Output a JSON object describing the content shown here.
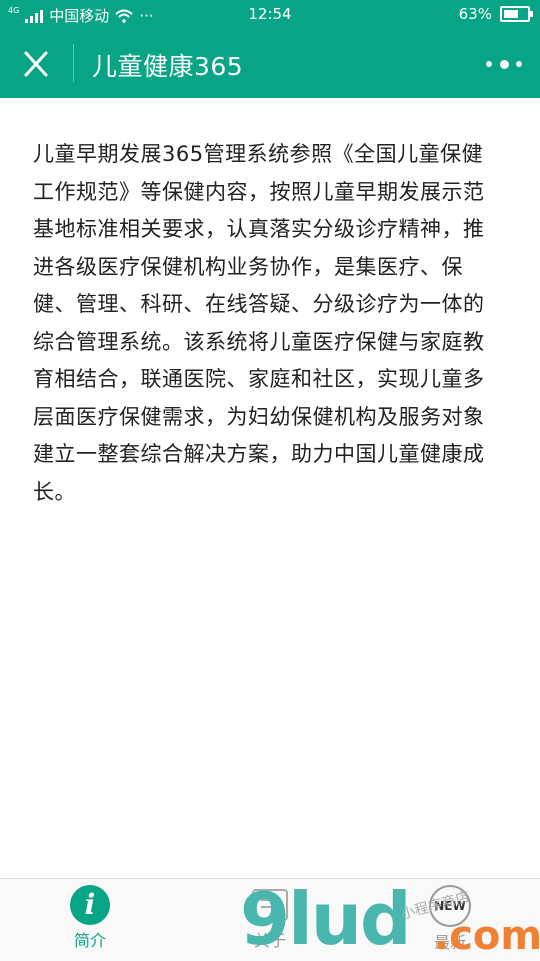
{
  "status_bar": {
    "network_tag": "4G",
    "carrier": "中国移动",
    "wifi_icon": "wifi-icon",
    "more": "···",
    "time": "12:54",
    "battery_percent": "63%",
    "battery_level": 0.63
  },
  "navbar": {
    "title": "儿童健康365",
    "close_icon": "close-icon",
    "more_icon": "more-dots-icon"
  },
  "content": {
    "paragraph": "儿童早期发展365管理系统参照《全国儿童保健工作规范》等保健内容，按照儿童早期发展示范基地标准相关要求，认真落实分级诊疗精神，推进各级医疗保健机构业务协作，是集医疗、保健、管理、科研、在线答疑、分级诊疗为一体的综合管理系统。该系统将儿童医疗保健与家庭教育相结合，联通医院、家庭和社区，实现儿童多层面医疗保健需求，为妇幼保健机构及服务对象建立一整套综合解决方案，助力中国儿童健康成长。"
  },
  "tabs": [
    {
      "label": "简介",
      "icon": "info-icon",
      "active": true,
      "glyph": "i"
    },
    {
      "label": "关于",
      "icon": "about-icon",
      "active": false
    },
    {
      "label": "最新",
      "icon": "new-icon",
      "active": false,
      "glyph": "NEW"
    }
  ],
  "colors": {
    "accent": "#07a586",
    "inactive_tab": "#999999"
  },
  "watermark": {
    "main": "9lud",
    "suffix": ".com",
    "caption": "小程序商店"
  }
}
